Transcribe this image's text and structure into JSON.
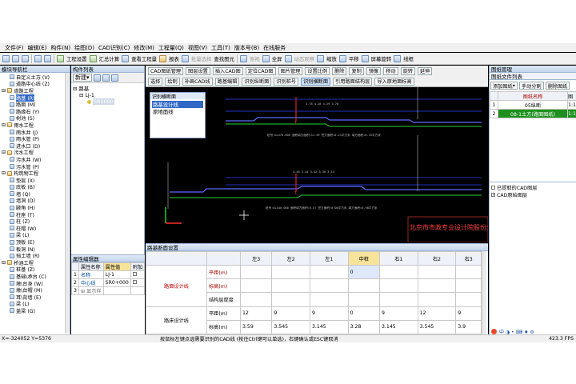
{
  "menu": [
    "文件(F)",
    "编辑(E)",
    "构件(N)",
    "绘图(D)",
    "CAD识别(C)",
    "修改(M)",
    "工程量(Q)",
    "视图(V)",
    "工具(T)",
    "版本号(B)",
    "在线服务"
  ],
  "toolbar": {
    "project_settings": "工程设置",
    "summary_calc": "汇总计算",
    "view_quantity": "查看工程量",
    "report": "报表",
    "batch_select": "批量选择",
    "find_element": "查找图元",
    "plan_view": "俯视",
    "full_screen": "全屏",
    "dynamic_observe": "动态观察",
    "zoom": "缩放",
    "pan": "平移",
    "screen_rotate": "屏幕旋转",
    "wireframe": "线框"
  },
  "left_panel": {
    "title": "模块导航栏",
    "items": [
      {
        "label": "自定义土方 (V)",
        "level": 2
      },
      {
        "label": "道路中心线 (Z)",
        "level": 2
      },
      {
        "label": "道路工程",
        "level": 1
      },
      {
        "label": "路基 (R)",
        "level": 2,
        "selected": true
      },
      {
        "label": "路面 (M)",
        "level": 2
      },
      {
        "label": "路缘石 (Y)",
        "level": 2
      },
      {
        "label": "树池 (S)",
        "level": 2
      },
      {
        "label": "雨水工程",
        "level": 1
      },
      {
        "label": "雨水井 (J)",
        "level": 2
      },
      {
        "label": "雨水管 (P)",
        "level": 2
      },
      {
        "label": "进水口 (D)",
        "level": 2
      },
      {
        "label": "污水工程",
        "level": 1
      },
      {
        "label": "污水井 (W)",
        "level": 2
      },
      {
        "label": "污水管 (P)",
        "level": 2
      },
      {
        "label": "构筑物工程",
        "level": 1
      },
      {
        "label": "垫层 (X)",
        "level": 2
      },
      {
        "label": "底板 (B)",
        "level": 2
      },
      {
        "label": "墙 (Q)",
        "level": 2
      },
      {
        "label": "墙洞 (D)",
        "level": 2
      },
      {
        "label": "腋角 (H)",
        "level": 2
      },
      {
        "label": "柱座 (T)",
        "level": 2
      },
      {
        "label": "柱 (Z)",
        "level": 2
      },
      {
        "label": "柱帽 (W)",
        "level": 2
      },
      {
        "label": "梁 (L)",
        "level": 2
      },
      {
        "label": "顶板 (E)",
        "level": 2
      },
      {
        "label": "板洞 (N)",
        "level": 2
      },
      {
        "label": "挡土墙 (R)",
        "level": 2
      },
      {
        "label": "桥涵工程",
        "level": 1
      },
      {
        "label": "桩基 (Z)",
        "level": 2
      },
      {
        "label": "基础\\承台 (C)",
        "level": 2
      },
      {
        "label": "墩\\台身 (W)",
        "level": 2
      },
      {
        "label": "墩\\台帽 (M)",
        "level": 2
      },
      {
        "label": "耳\\背墙 (E)",
        "level": 2
      },
      {
        "label": "梁 (L)",
        "level": 2
      },
      {
        "label": "盖梁 (G)",
        "level": 2
      }
    ]
  },
  "component_list": {
    "title": "构件列表",
    "new_btn": "新建",
    "root": "路基",
    "child": "LJ-1",
    "leaf": "SR0000"
  },
  "attr_editor": {
    "title": "属性编辑器",
    "headers": [
      "属性名称",
      "属性值",
      "附加"
    ],
    "rows": [
      {
        "n": "1",
        "name": "名称",
        "value": "LJ-1"
      },
      {
        "n": "2",
        "name": "中心线",
        "value": "SR0+000"
      },
      {
        "n": "3",
        "name": "显示样",
        "value": ""
      }
    ]
  },
  "cad_toolbar": {
    "row1": [
      "CAD图纸管理",
      "图层设置",
      "插入CAD图",
      "定位CAD图",
      "图片管理",
      "设置比例",
      "删除",
      "复制",
      "镜像",
      "移动",
      "旋转",
      "延伸"
    ],
    "row2": [
      "选择",
      "绘制",
      "补画CAD线",
      "路基编辑",
      "识别纵断面",
      "识别桩号",
      "识别横断面",
      "引用路面结构层",
      "导入原地面标高"
    ],
    "active": "识别横断面"
  },
  "popup": {
    "title": "识别横断面",
    "items": [
      "路基设计线",
      "原地面线"
    ],
    "selected": 0
  },
  "cad_drawing": {
    "t1_top": "3.78 4.28 4.29 3.78",
    "t1_bottom": "桩号:0+470.000 面积填方面积=11.49 挖方面积=0.21平方米 填方面积=0.31平方米",
    "t2_top": "3.40 3.44 3.42 3.36 3.14",
    "t2_bottom": "桩号:0+440.000 面积填方面积=5.57 挖方面积=0.00平方米 填方面积=0.98平方米",
    "company": "北京市市政专业设计院股份公",
    "mark_top": "T",
    "mark_bottom": "T"
  },
  "section_settings": {
    "title": "路基断面设置",
    "col_headers": [
      "左3",
      "左2",
      "左1",
      "中桩",
      "右1",
      "右2",
      "右3"
    ],
    "groups": [
      {
        "name": "路面设计线",
        "rows": [
          {
            "unit": "平距(m)",
            "values": [
              "",
              "",
              "",
              "0",
              "",
              "",
              ""
            ]
          },
          {
            "unit": "标高(m)",
            "values": [
              "",
              "",
              "",
              "",
              "",
              "",
              ""
            ]
          },
          {
            "unit": "结构层厚度",
            "values": [
              "",
              "",
              "",
              "",
              "",
              "",
              ""
            ]
          }
        ]
      },
      {
        "name": "路床设计线",
        "rows": [
          {
            "unit": "平距(m)",
            "values": [
              "12",
              "9",
              "9",
              "0",
              "9",
              "12",
              "9"
            ]
          },
          {
            "unit": "标高(m)",
            "values": [
              "3.59",
              "3.545",
              "3.145",
              "3.28",
              "3.145",
              "3.545",
              "3.9"
            ]
          }
        ]
      }
    ]
  },
  "right_panel": {
    "title": "图纸管理",
    "subtitle": "图纸文件列表",
    "buttons": [
      "添加图纸",
      "手动分割",
      "删除图纸"
    ],
    "col_header": "图纸名称",
    "col_header2": "图",
    "rows": [
      {
        "n": "1",
        "name": "05纵断",
        "extra": "1:1"
      },
      {
        "n": "2",
        "name": "08-1土方(路面图纸)",
        "extra": "1:1"
      }
    ],
    "layers": [
      "已提取的CAD图层",
      "CAD原始图层"
    ]
  },
  "status": {
    "coords": "X=-324052 Y=5376",
    "hint": "按鼠标左键点选需要识别的CAD线 (按住Ctrl键可以单选)，右键确认或ESC键取消",
    "fps": "423.3 FPS"
  }
}
